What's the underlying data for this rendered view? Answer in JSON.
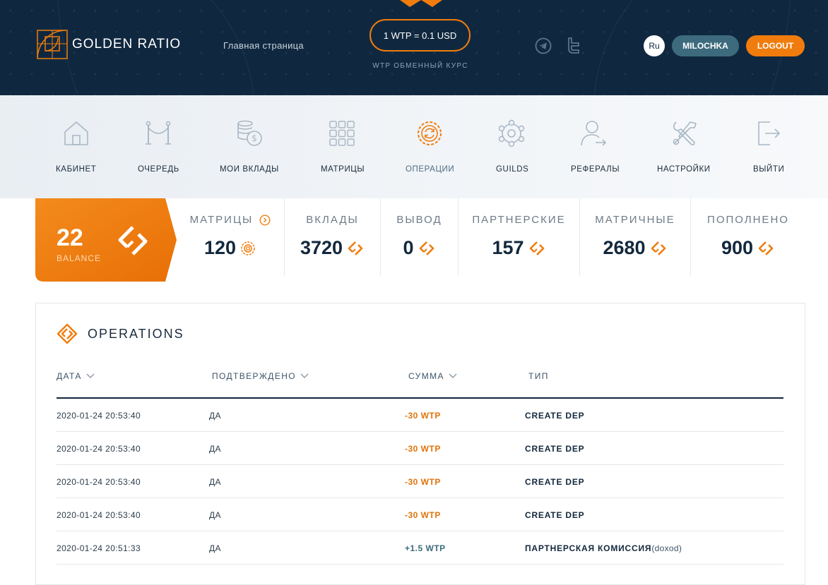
{
  "header": {
    "logo_text": "GOLDEN RATIO",
    "home_link": "Главная страница",
    "rate": "1 WTP = 0.1 USD",
    "rate_caption": "WTP ОБМЕННЫЙ КУРС",
    "lang": "Ru",
    "username": "MILOCHKA",
    "logout": "LOGOUT"
  },
  "nav": {
    "items": [
      {
        "label": "КАБИНЕТ",
        "icon": "house-icon"
      },
      {
        "label": "ОЧЕРЕДЬ",
        "icon": "queue-icon"
      },
      {
        "label": "МОИ ВКЛАДЫ",
        "icon": "coins-icon"
      },
      {
        "label": "МАТРИЦЫ",
        "icon": "grid-icon"
      },
      {
        "label": "ОПЕРАЦИИ",
        "icon": "operations-icon"
      },
      {
        "label": "GUILDS",
        "icon": "guilds-icon"
      },
      {
        "label": "РЕФЕРАЛЫ",
        "icon": "referral-icon"
      },
      {
        "label": "НАСТРОЙКИ",
        "icon": "tools-icon"
      },
      {
        "label": "ВЫЙТИ",
        "icon": "exit-icon"
      }
    ],
    "active_index": 4
  },
  "balance": {
    "value": "22",
    "label": "BALANCE"
  },
  "stats": [
    {
      "label": "МАТРИЦЫ",
      "value": "120"
    },
    {
      "label": "ВКЛАДЫ",
      "value": "3720"
    },
    {
      "label": "ВЫВОД",
      "value": "0"
    },
    {
      "label": "ПАРТНЕРСКИЕ",
      "value": "157"
    },
    {
      "label": "МАТРИЧНЫЕ",
      "value": "2680"
    },
    {
      "label": "ПОПОЛНЕНО",
      "value": "900"
    }
  ],
  "operations": {
    "title": "OPERATIONS",
    "columns": {
      "date": "ДАТА",
      "confirmed": "ПОДТВЕРЖДЕНО",
      "sum": "СУММА",
      "type": "ТИП"
    },
    "rows": [
      {
        "date": "2020-01-24 20:53:40",
        "confirmed": "ДА",
        "sum": "-30 WTP",
        "type": "CREATE DEP",
        "type_extra": ""
      },
      {
        "date": "2020-01-24 20:53:40",
        "confirmed": "ДА",
        "sum": "-30 WTP",
        "type": "CREATE DEP",
        "type_extra": ""
      },
      {
        "date": "2020-01-24 20:53:40",
        "confirmed": "ДА",
        "sum": "-30 WTP",
        "type": "CREATE DEP",
        "type_extra": ""
      },
      {
        "date": "2020-01-24 20:53:40",
        "confirmed": "ДА",
        "sum": "-30 WTP",
        "type": "CREATE DEP",
        "type_extra": ""
      },
      {
        "date": "2020-01-24 20:51:33",
        "confirmed": "ДА",
        "sum": "+1.5 WTP",
        "type": "ПАРТНЕРСКАЯ КОМИССИЯ",
        "type_extra": "(doxod)"
      }
    ]
  },
  "colors": {
    "navy": "#10283f",
    "orange": "#f07c0d",
    "negative": "#e0740c",
    "positive": "#3d6b7d"
  }
}
